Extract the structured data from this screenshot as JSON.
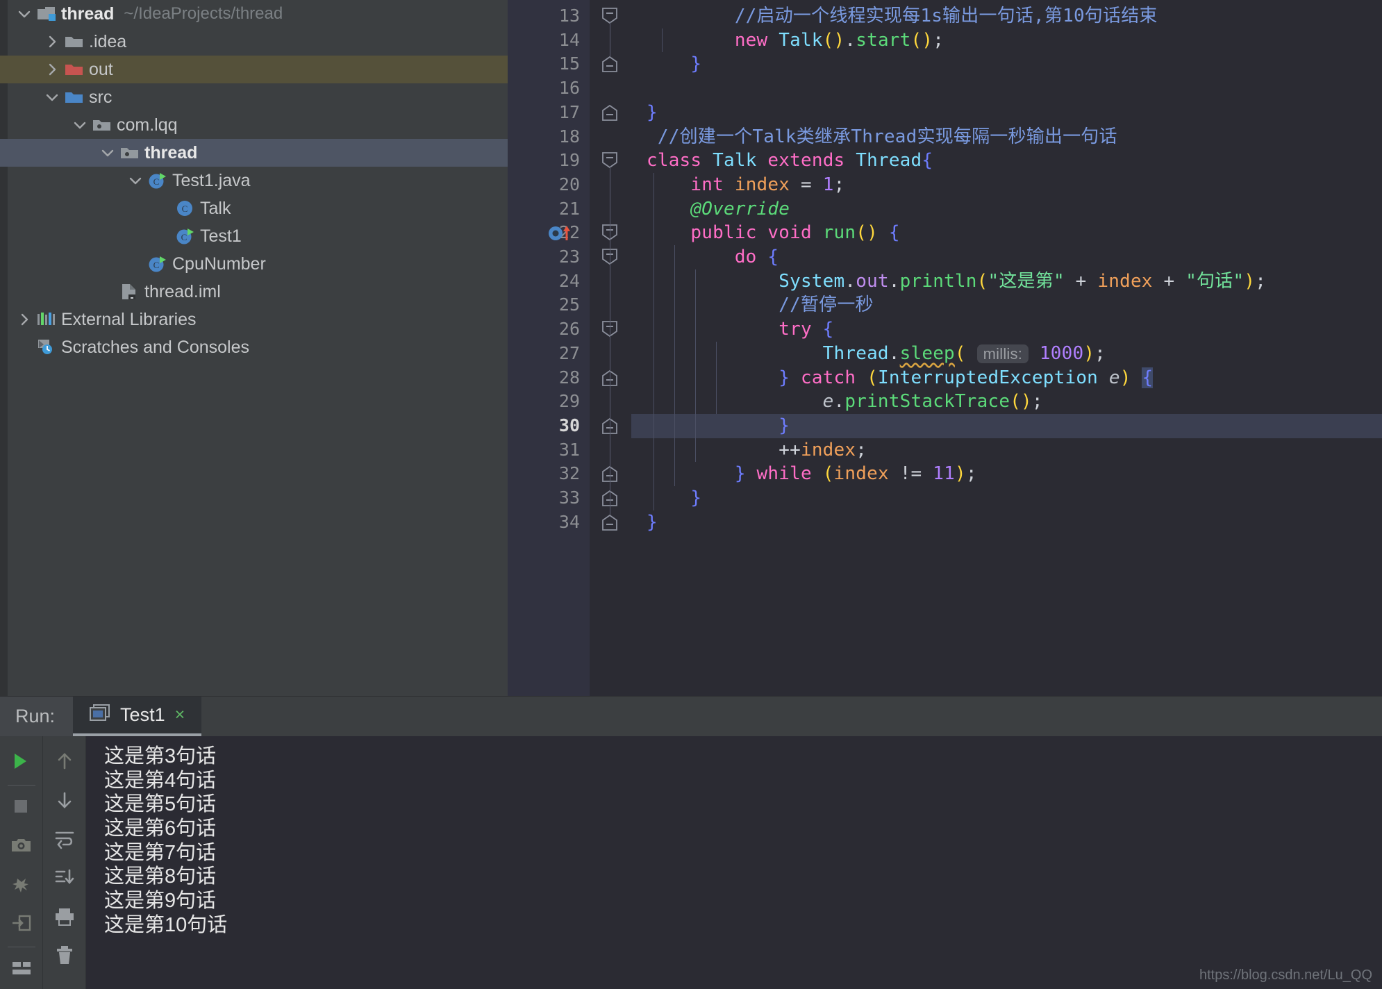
{
  "project": {
    "title": "thread",
    "path": "~/IdeaProjects/thread",
    "items": [
      {
        "label": "thread",
        "sublabel": "~/IdeaProjects/thread",
        "icon": "module-folder-icon",
        "arrow": "chevron-down",
        "indent": 0,
        "state": "normal",
        "bold": true
      },
      {
        "label": ".idea",
        "sublabel": "",
        "icon": "folder-icon",
        "arrow": "chevron-right",
        "indent": 1,
        "state": "normal",
        "bold": false
      },
      {
        "label": "out",
        "sublabel": "",
        "icon": "folder-excluded-icon",
        "arrow": "chevron-right",
        "indent": 1,
        "state": "olive",
        "bold": false
      },
      {
        "label": "src",
        "sublabel": "",
        "icon": "folder-source-icon",
        "arrow": "chevron-down",
        "indent": 1,
        "state": "normal",
        "bold": false
      },
      {
        "label": "com.lqq",
        "sublabel": "",
        "icon": "package-icon",
        "arrow": "chevron-down",
        "indent": 2,
        "state": "normal",
        "bold": false
      },
      {
        "label": "thread",
        "sublabel": "",
        "icon": "package-icon",
        "arrow": "chevron-down",
        "indent": 3,
        "state": "selected",
        "bold": true
      },
      {
        "label": "Test1.java",
        "sublabel": "",
        "icon": "java-runnable-icon",
        "arrow": "chevron-down",
        "indent": 4,
        "state": "normal",
        "bold": false
      },
      {
        "label": "Talk",
        "sublabel": "",
        "icon": "java-class-icon",
        "arrow": "none",
        "indent": 5,
        "state": "normal",
        "bold": false
      },
      {
        "label": "Test1",
        "sublabel": "",
        "icon": "java-runnable-icon",
        "arrow": "none",
        "indent": 5,
        "state": "normal",
        "bold": false
      },
      {
        "label": "CpuNumber",
        "sublabel": "",
        "icon": "java-runnable-icon",
        "arrow": "none",
        "indent": 4,
        "state": "normal",
        "bold": false
      },
      {
        "label": "thread.iml",
        "sublabel": "",
        "icon": "iml-file-icon",
        "arrow": "none",
        "indent": 3,
        "state": "normal",
        "bold": false
      },
      {
        "label": "External Libraries",
        "sublabel": "",
        "icon": "libraries-icon",
        "arrow": "chevron-right",
        "indent": 0,
        "state": "normal",
        "bold": false
      },
      {
        "label": "Scratches and Consoles",
        "sublabel": "",
        "icon": "scratches-icon",
        "arrow": "none",
        "indent": 0,
        "state": "normal",
        "bold": false
      }
    ]
  },
  "editor": {
    "first_line": 13,
    "current_line": 30,
    "line_numbers": [
      13,
      14,
      15,
      16,
      17,
      18,
      19,
      20,
      21,
      22,
      23,
      24,
      25,
      26,
      27,
      28,
      29,
      30,
      31,
      32,
      33,
      34
    ],
    "gutter_icons": [
      {
        "line": 22,
        "name": "override-method-icon"
      }
    ],
    "fold_markers": [
      {
        "line": 13,
        "type": "collapse"
      },
      {
        "line": 15,
        "type": "collapse-end"
      },
      {
        "line": 17,
        "type": "collapse-end"
      },
      {
        "line": 19,
        "type": "collapse"
      },
      {
        "line": 22,
        "type": "collapse"
      },
      {
        "line": 23,
        "type": "collapse"
      },
      {
        "line": 26,
        "type": "collapse"
      },
      {
        "line": 28,
        "type": "collapse-end"
      },
      {
        "line": 30,
        "type": "collapse-end"
      },
      {
        "line": 32,
        "type": "collapse-end"
      },
      {
        "line": 33,
        "type": "collapse-end"
      },
      {
        "line": 34,
        "type": "collapse-end"
      }
    ],
    "code_text": {
      "l13": "        //启动一个线程实现每1s输出一句话,第10句话结束",
      "l14": "        new Talk().start();",
      "l15": "    }",
      "l16": "",
      "l17": "}",
      "l18": " //创建一个Talk类继承Thread实现每隔一秒输出一句话",
      "l19": "class Talk extends Thread{",
      "l20": "    int index = 1;",
      "l21": "    @Override",
      "l22": "    public void run() {",
      "l23": "        do {",
      "l24": "            System.out.println(\"这是第\" + index + \"句话\");",
      "l25": "            //暂停一秒",
      "l26": "            try {",
      "l27": "                Thread.sleep( millis: 1000);",
      "l28": "            } catch (InterruptedException e) {",
      "l29": "                e.printStackTrace();",
      "l30": "            }",
      "l31": "            ++index;",
      "l32": "        } while (index != 11);",
      "l33": "    }",
      "l34": "}"
    },
    "tokens": {
      "comment13": "//启动一个线程实现每1s输出一句话,第10句话结束",
      "kw_new": "new",
      "type_talk": "Talk",
      "meth_start": "start",
      "comment18": "//创建一个Talk类继承Thread实现每隔一秒输出一句话",
      "kw_class": "class",
      "kw_extends": "extends",
      "type_thread": "Thread",
      "kw_int": "int",
      "fld_index": "index",
      "num_1": "1",
      "anno_override": "@Override",
      "kw_public": "public",
      "kw_void": "void",
      "meth_run": "run",
      "kw_do": "do",
      "type_system": "System",
      "prop_out": "out",
      "meth_println": "println",
      "str_zheshidi": "\"这是第\"",
      "str_juhua": "\"句话\"",
      "comment25": "//暂停一秒",
      "kw_try": "try",
      "meth_sleep": "sleep",
      "hint_millis": "millis:",
      "num_1000": "1000",
      "kw_catch": "catch",
      "type_ie": "InterruptedException",
      "var_e": "e",
      "meth_pst": "printStackTrace",
      "op_inc": "++",
      "kw_while": "while",
      "op_neq": "!=",
      "num_11": "11"
    }
  },
  "run_panel": {
    "run_label": "Run:",
    "tab_name": "Test1",
    "tab_close": "×",
    "toolbar_primary": [
      {
        "name": "rerun-icon",
        "title": "Rerun"
      },
      {
        "name": "stop-icon",
        "title": "Stop"
      },
      {
        "name": "camera-icon",
        "title": "Snapshot"
      },
      {
        "name": "debug-icon",
        "title": "Debug"
      },
      {
        "name": "export-icon",
        "title": "Export"
      },
      {
        "name": "layout-icon",
        "title": "Layout"
      }
    ],
    "toolbar_secondary": [
      {
        "name": "arrow-up-icon",
        "title": "Up"
      },
      {
        "name": "arrow-down-icon",
        "title": "Down"
      },
      {
        "name": "soft-wrap-icon",
        "title": "Soft-Wrap"
      },
      {
        "name": "scroll-to-end-icon",
        "title": "Scroll to End"
      },
      {
        "name": "print-icon",
        "title": "Print"
      },
      {
        "name": "trash-icon",
        "title": "Clear All"
      }
    ],
    "console_lines": [
      "这是第3句话",
      "这是第4句话",
      "这是第5句话",
      "这是第6句话",
      "这是第7句话",
      "这是第8句话",
      "这是第9句话",
      "这是第10句话"
    ]
  },
  "watermark": "https://blog.csdn.net/Lu_QQ",
  "colors": {
    "editor_bg": "#2b2b33",
    "panel_bg": "#3c3f41",
    "gutter_bg": "#313240",
    "selection_blue": "#4e5564",
    "excluded_olive": "#55513a",
    "current_line": "#3b3f51",
    "accent_green": "#5cdb7a",
    "keyword_pink": "#ff6ec7",
    "type_cyan": "#7fdfff",
    "string_green": "#72e39b",
    "number_purple": "#b07fff",
    "comment_blue": "#7a9ae0"
  }
}
